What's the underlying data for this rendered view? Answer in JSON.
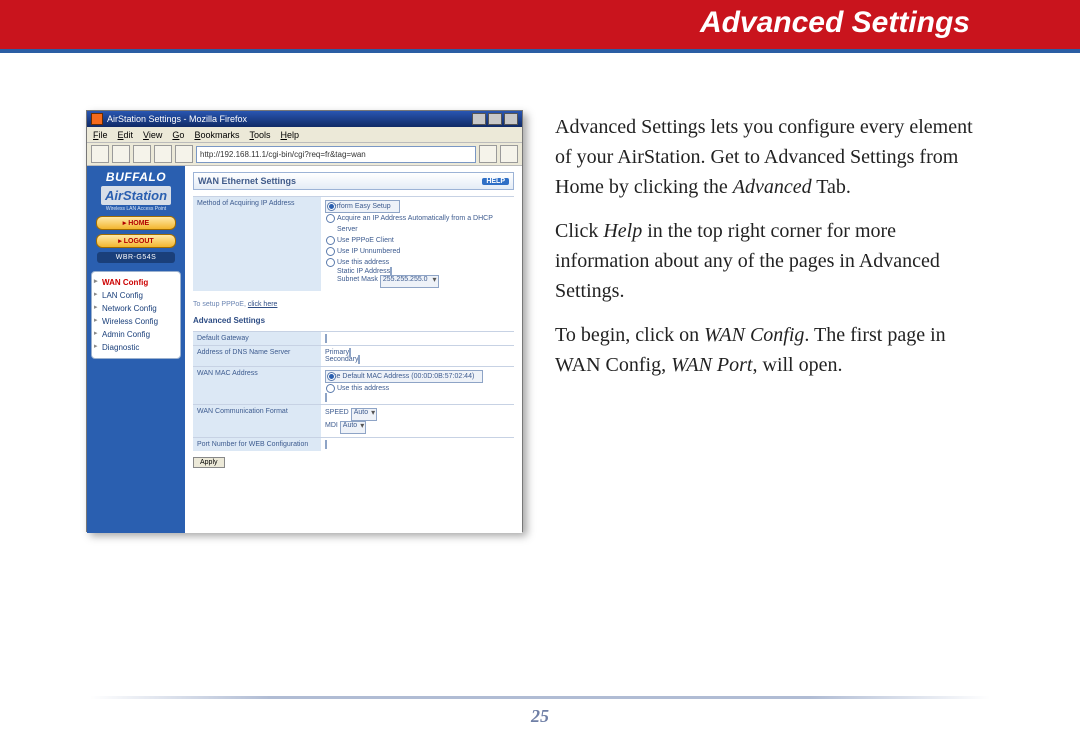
{
  "page": {
    "header_title": "Advanced Settings",
    "number": "25"
  },
  "body": {
    "p1_a": "Advanced Settings lets you configure every element of your AirStation.  Get to Advanced Settings from Home by clicking the ",
    "p1_i": "Advanced",
    "p1_b": " Tab.",
    "p2_a": "Click ",
    "p2_i": "Help",
    "p2_b": " in the top right corner for more information about any of the pages in Advanced Settings.",
    "p3_a": "To begin, click on ",
    "p3_i1": "WAN Config",
    "p3_b": ".  The first page in WAN Config, ",
    "p3_i2": "WAN Port",
    "p3_c": ", will open."
  },
  "shot": {
    "window_title": "AirStation Settings - Mozilla Firefox",
    "menu": {
      "file": "File",
      "edit": "Edit",
      "view": "View",
      "go": "Go",
      "bookmarks": "Bookmarks",
      "tools": "Tools",
      "help": "Help"
    },
    "url": "http://192.168.11.1/cgi-bin/cgi?req=fr&tag=wan",
    "brand": {
      "buffalo": "BUFFALO",
      "air": "AirStation",
      "sub": "Wireless LAN Access Point"
    },
    "pill_home": "▸ HOME",
    "pill_logout": "▸ LOGOUT",
    "model": "WBR-G54S",
    "side_items": [
      "WAN Config",
      "LAN Config",
      "Network Config",
      "Wireless Config",
      "Admin Config",
      "Diagnostic"
    ],
    "panel_title": "WAN Ethernet Settings",
    "help": "HELP",
    "row_method": "Method of Acquiring IP Address",
    "opt_easy": "Perform Easy Setup",
    "opt_dhcp": "Acquire an IP Address Automatically from a DHCP Server",
    "opt_pppoe": "Use PPPoE Client",
    "opt_unn": "Use IP Unnumbered",
    "opt_this": "Use this address",
    "lbl_static": "Static IP Address",
    "lbl_subnet": "Subnet Mask",
    "pppoe_a": "To setup PPPoE, ",
    "pppoe_link": "click here",
    "adv_title": "Advanced Settings",
    "row_gw": "Default Gateway",
    "row_dns": "Address of DNS Name Server",
    "dns_p": "Primary",
    "dns_s": "Secondary",
    "row_mac": "WAN MAC Address",
    "mac_def": "Use Default MAC Address (00:0D:0B:57:02:44)",
    "mac_this": "Use this address",
    "row_fmt": "WAN Communication Format",
    "fmt_speed": "SPEED",
    "fmt_mdi": "MDI",
    "fmt_auto": "Auto",
    "row_port": "Port Number for WEB Configuration",
    "apply": "Apply"
  }
}
